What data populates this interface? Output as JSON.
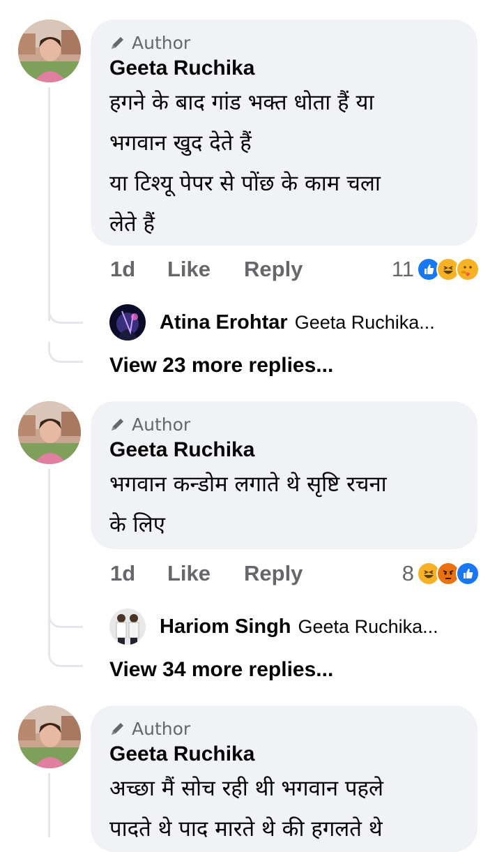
{
  "comments": [
    {
      "badge": "Author",
      "name": "Geeta Ruchika",
      "text": "हगने के बाद गांड भक्त धोता हैं या\nभगवान खुद देते हैं\nया टिश्यू पेपर से पोंछ के काम चला\nलेते हैं",
      "time": "1d",
      "like_label": "Like",
      "reply_label": "Reply",
      "reaction_count": "11",
      "reactions": [
        "like-icon",
        "haha-icon",
        "care-icon"
      ],
      "reply_preview": {
        "name": "Atina Erohtar",
        "text": "Geeta Ruchika..."
      },
      "view_more": "View 23 more replies..."
    },
    {
      "badge": "Author",
      "name": "Geeta Ruchika",
      "text": "भगवान कन्डोम लगाते थे सृष्टि रचना\nके लिए",
      "time": "1d",
      "like_label": "Like",
      "reply_label": "Reply",
      "reaction_count": "8",
      "reactions": [
        "haha-icon",
        "angry-icon",
        "like-icon"
      ],
      "reply_preview": {
        "name": "Hariom Singh",
        "text": "Geeta Ruchika..."
      },
      "view_more": "View 34 more replies..."
    },
    {
      "badge": "Author",
      "name": "Geeta Ruchika",
      "text": "अच्छा मैं सोच रही थी भगवान पहले\nपादते थे पाद मारते थे की हगलते थे"
    }
  ],
  "colors": {
    "bubble": "#f0f2f5",
    "secondary_text": "#65676b",
    "like_blue": "#1877f2",
    "haha_yellow": "#f7b125",
    "angry_red": "#e9710f"
  }
}
